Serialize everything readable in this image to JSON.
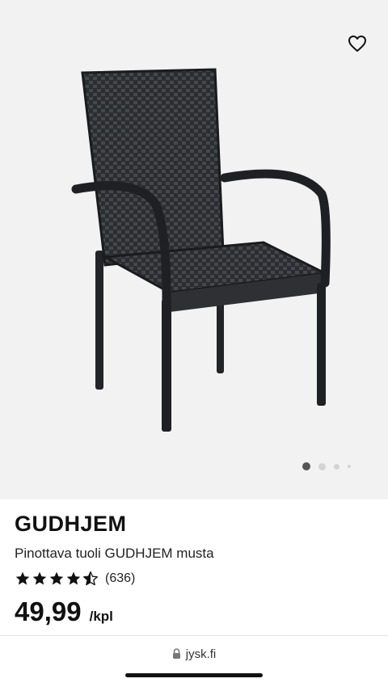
{
  "product": {
    "name": "GUDHJEM",
    "description": "Pinottava tuoli GUDHJEM musta",
    "rating_value": 4.5,
    "rating_count": "(636)",
    "price": "49,99",
    "unit": "/kpl"
  },
  "gallery": {
    "image_count": 4,
    "active_index": 0
  },
  "browser": {
    "url": "jysk.fi"
  },
  "colors": {
    "image_background": "#f2f2f2",
    "text": "#111111",
    "active_dot": "#555555"
  },
  "icons": [
    "heart-outline-icon",
    "star-icon",
    "star-half-icon",
    "lock-icon"
  ]
}
